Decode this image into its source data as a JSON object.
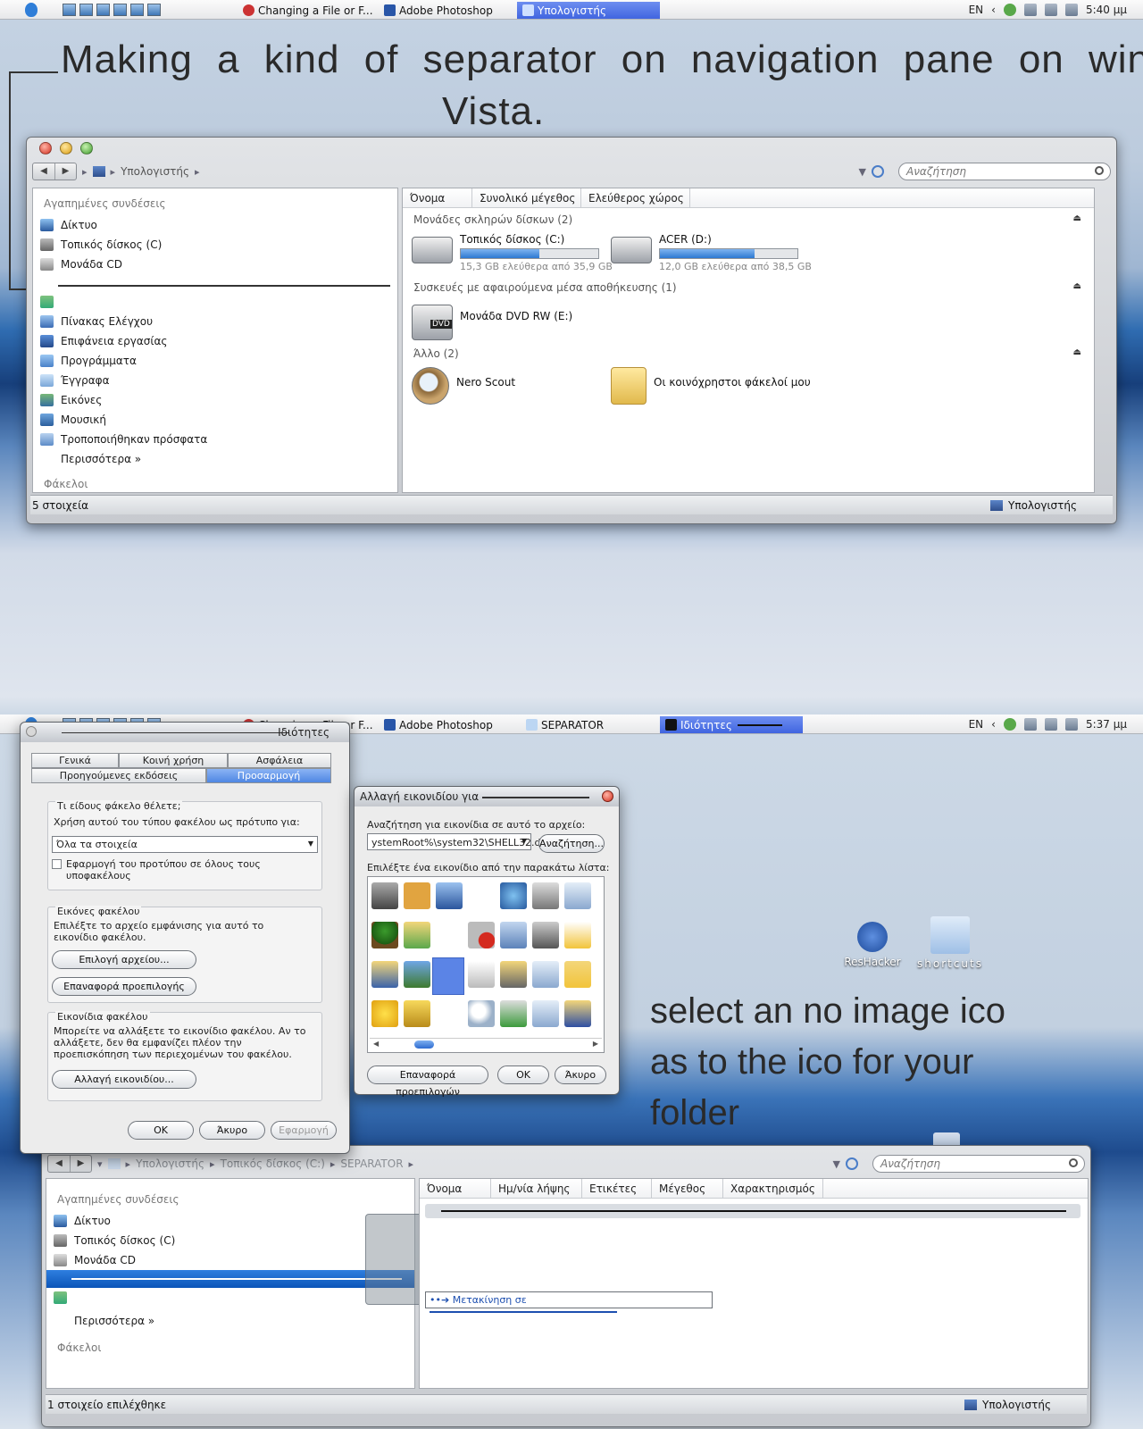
{
  "top": {
    "taskbar": {
      "tasks": [
        "Changing a File or F...",
        "Adobe Photoshop",
        "Υπολογιστής"
      ],
      "lang": "EN",
      "clock": "5:40 μμ"
    },
    "heading_line1": "Making a kind of  separator on navigation pane on windows",
    "heading_line2": "Vista.",
    "explorer": {
      "breadcrumb": "Υπολογιστής",
      "search_placeholder": "Αναζήτηση",
      "favorites_header": "Αγαπημένες συνδέσεις",
      "favorites": [
        "Δίκτυο",
        "Τοπικός δίσκος (C)",
        "Μονάδα CD"
      ],
      "links": [
        "Πίνακας Ελέγχου",
        "Επιφάνεια εργασίας",
        "Προγράμματα",
        "Έγγραφα",
        "Εικόνες",
        "Μουσική",
        "Τροποποιήθηκαν πρόσφατα",
        "Περισσότερα  »"
      ],
      "folders_label": "Φάκελοι",
      "columns": [
        "Όνομα",
        "Συνολικό μέγεθος",
        "Ελεύθερος χώρος"
      ],
      "group_hdd": "Μονάδες σκληρών δίσκων (2)",
      "drive_c": {
        "name": "Τοπικός δίσκος (C:)",
        "sub": "15,3 GB ελεύθερα από 35,9 GB",
        "used_fraction": 0.57
      },
      "drive_d": {
        "name": "ACER (D:)",
        "sub": "12,0 GB ελεύθερα από 38,5 GB",
        "used_fraction": 0.69
      },
      "group_removable": "Συσκευές με αφαιρούμενα μέσα αποθήκευσης (1)",
      "dvd": "Μονάδα DVD RW (E:)",
      "dvd_label": "DVD",
      "group_other": "Άλλο (2)",
      "nero": "Nero Scout",
      "shared": "Οι κοινόχρηστοι φάκελοί μου",
      "status_left": "5 στοιχεία",
      "status_right": "Υπολογιστής"
    }
  },
  "bottom": {
    "taskbar": {
      "tasks": [
        "Changing a File or F...",
        "Adobe Photoshop",
        "SEPARATOR",
        "Ιδιότητες"
      ],
      "lang": "EN",
      "clock": "5:37 μμ"
    },
    "props": {
      "title": "Ιδιότητες",
      "tabs": [
        "Γενικά",
        "Κοινή χρήση",
        "Ασφάλεια",
        "Προηγούμενες εκδόσεις",
        "Προσαρμογή"
      ],
      "q_type": "Τι είδους φάκελο θέλετε;",
      "template_label": "Χρήση αυτού του τύπου φακέλου ως πρότυπο για:",
      "template_value": "Όλα τα στοιχεία",
      "apply_sub": "Εφαρμογή του προτύπου σε όλους τους υποφακέλους",
      "pics_title": "Εικόνες φακέλου",
      "pics_desc": "Επιλέξτε το αρχείο εμφάνισης για αυτό το εικονίδιο φακέλου.",
      "choose_file": "Επιλογή αρχείου...",
      "restore_default": "Επαναφορά προεπιλογής",
      "icons_title": "Εικονίδια φακέλου",
      "icons_desc": "Μπορείτε να αλλάξετε το εικονίδιο φακέλου. Αν το αλλάξετε, δεν θα εμφανίζει πλέον την προεπισκόπηση των περιεχομένων του φακέλου.",
      "change_icon": "Αλλαγή εικονιδίου...",
      "ok": "OK",
      "cancel": "Άκυρο",
      "apply": "Εφαρμογή"
    },
    "changeicon": {
      "title": "Αλλαγή εικονιδίου για",
      "search_label": "Αναζήτηση για εικονίδια σε αυτό το αρχείο:",
      "path": "ystemRoot%\\system32\\SHELL32.dll",
      "browse": "Αναζήτηση...",
      "list_label": "Επιλέξτε ένα εικονίδιο από την παρακάτω λίστα:",
      "restore": "Επαναφορά προεπιλογών",
      "ok": "OK",
      "cancel": "Άκυρο"
    },
    "note": [
      "select an no image ico",
      "as to the ico for your",
      "folder"
    ],
    "desktop": [
      "ResHacker",
      "shortcuts"
    ],
    "explorer": {
      "breadcrumb": [
        "Υπολογιστής",
        "Τοπικός δίσκος (C:)",
        "SEPARATOR"
      ],
      "search_placeholder": "Αναζήτηση",
      "favorites_header": "Αγαπημένες συνδέσεις",
      "favorites": [
        "Δίκτυο",
        "Τοπικός δίσκος (C)",
        "Μονάδα CD"
      ],
      "more": "Περισσότερα  »",
      "folders_label": "Φάκελοι",
      "columns": [
        "Όνομα",
        "Ημ/νία λήψης",
        "Ετικέτες",
        "Μέγεθος",
        "Χαρακτηρισμός"
      ],
      "move_tip": "Μετακίνηση σε",
      "status_left": "1 στοιχείο επιλέχθηκε",
      "status_right": "Υπολογιστής"
    }
  }
}
